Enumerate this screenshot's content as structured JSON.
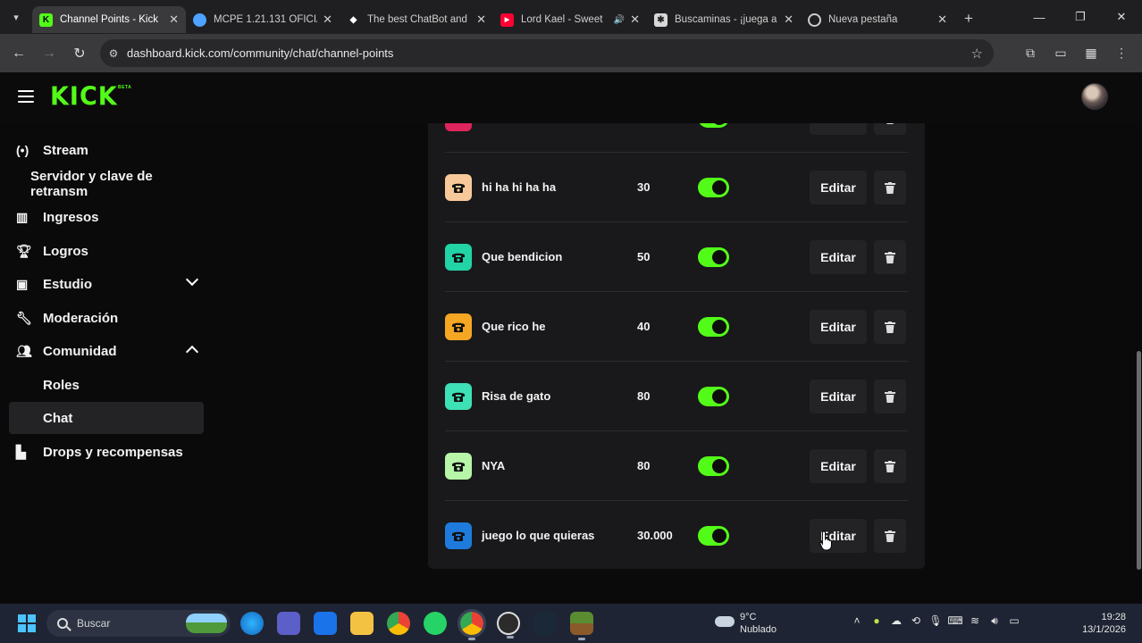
{
  "browser": {
    "tabs": [
      {
        "title": "Channel Points - Kick",
        "favicon": "kick-icon",
        "color": "#53fc18",
        "active": true
      },
      {
        "title": "MCPE 1.21.131 OFICIA",
        "favicon": "globe-icon",
        "color": "#4da3ff",
        "active": false
      },
      {
        "title": "The best ChatBot and",
        "favicon": "diamond-icon",
        "color": "#ffffff",
        "active": false
      },
      {
        "title": "Lord Kael - Sweet",
        "favicon": "youtube-icon",
        "color": "#ff0033",
        "active": false,
        "audio": true
      },
      {
        "title": "Buscaminas - ¡juega a",
        "favicon": "mine-icon",
        "color": "#cccccc",
        "active": false
      },
      {
        "title": "Nueva pestaña",
        "favicon": "chrome-icon",
        "color": "#cccccc",
        "active": false
      }
    ],
    "url": "dashboard.kick.com/community/chat/channel-points"
  },
  "header": {
    "logo": "KICK",
    "badge": "BETA"
  },
  "sidebar": {
    "items": [
      {
        "label": "Stream",
        "icon": "broadcast-icon"
      },
      {
        "label": "Servidor y clave de retransm",
        "icon": ""
      },
      {
        "label": "Ingresos",
        "icon": "chart-icon"
      },
      {
        "label": "Logros",
        "icon": "trophy-icon"
      },
      {
        "label": "Estudio",
        "icon": "studio-icon"
      },
      {
        "label": "Moderación",
        "icon": "wrench-icon"
      },
      {
        "label": "Comunidad",
        "icon": "users-icon"
      },
      {
        "label": "Roles",
        "icon": ""
      },
      {
        "label": "Chat",
        "icon": ""
      },
      {
        "label": "Drops y recompensas",
        "icon": "gift-icon"
      }
    ]
  },
  "rewards": {
    "edit_label": "Editar",
    "items": [
      {
        "name": "hi ha hi ha ha",
        "cost": "30",
        "color": "#f7c99a",
        "enabled": true
      },
      {
        "name": "Que bendicion",
        "cost": "50",
        "color": "#22d3a6",
        "enabled": true
      },
      {
        "name": "Que rico he",
        "cost": "40",
        "color": "#f5a623",
        "enabled": true
      },
      {
        "name": "Risa de gato",
        "cost": "80",
        "color": "#3ee0b5",
        "enabled": true
      },
      {
        "name": "NYA",
        "cost": "80",
        "color": "#b7f5a8",
        "enabled": true
      },
      {
        "name": "juego lo que quieras",
        "cost": "30.000",
        "color": "#1e7bdc",
        "enabled": true
      }
    ],
    "partial_top": {
      "color": "#e0245e"
    }
  },
  "taskbar": {
    "search_placeholder": "Buscar",
    "weather_temp": "9°C",
    "weather_desc": "Nublado",
    "time": "19:28",
    "date": "13/1/2026"
  }
}
